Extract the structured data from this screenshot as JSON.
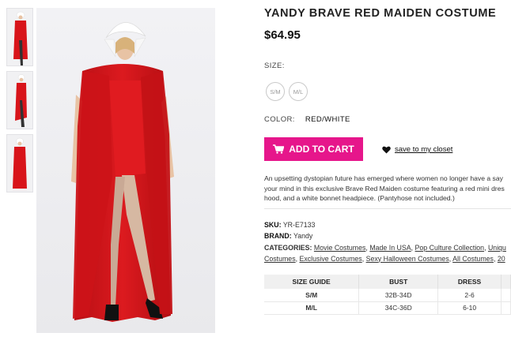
{
  "product": {
    "title": "YANDY BRAVE RED MAIDEN COSTUME",
    "price": "$64.95",
    "size_label": "SIZE:",
    "sizes": [
      "S/M",
      "M/L"
    ],
    "color_label": "COLOR:",
    "color_value": "RED/WHITE",
    "add_to_cart": "ADD TO CART",
    "save_to_closet": "save to my closet",
    "description_lines": [
      "An upsetting dystopian future has emerged where women no longer have a say",
      "your mind in this exclusive Brave Red Maiden costume featuring a red mini dres",
      "hood, and a white bonnet headpiece. (Pantyhose not included.)"
    ],
    "sku_label": "SKU:",
    "sku_value": "YR-E7133",
    "brand_label": "BRAND:",
    "brand_value": "Yandy",
    "categories_label": "CATEGORIES:",
    "categories_line1": [
      "Movie Costumes",
      "Made In USA",
      "Pop Culture Collection",
      "Uniqu"
    ],
    "categories_line2": [
      "Costumes",
      "Exclusive Costumes",
      "Sexy Halloween Costumes",
      "All Costumes",
      "20"
    ]
  },
  "size_guide": {
    "headers": [
      "SIZE GUIDE",
      "BUST",
      "DRESS"
    ],
    "rows": [
      [
        "S/M",
        "32B-34D",
        "2-6"
      ],
      [
        "M/L",
        "34C-36D",
        "6-10"
      ]
    ]
  },
  "colors": {
    "accent": "#e6168b",
    "costume_red": "#d8141a",
    "bonnet_white": "#ffffff"
  },
  "icons": [
    "cart-icon",
    "heart-icon"
  ]
}
